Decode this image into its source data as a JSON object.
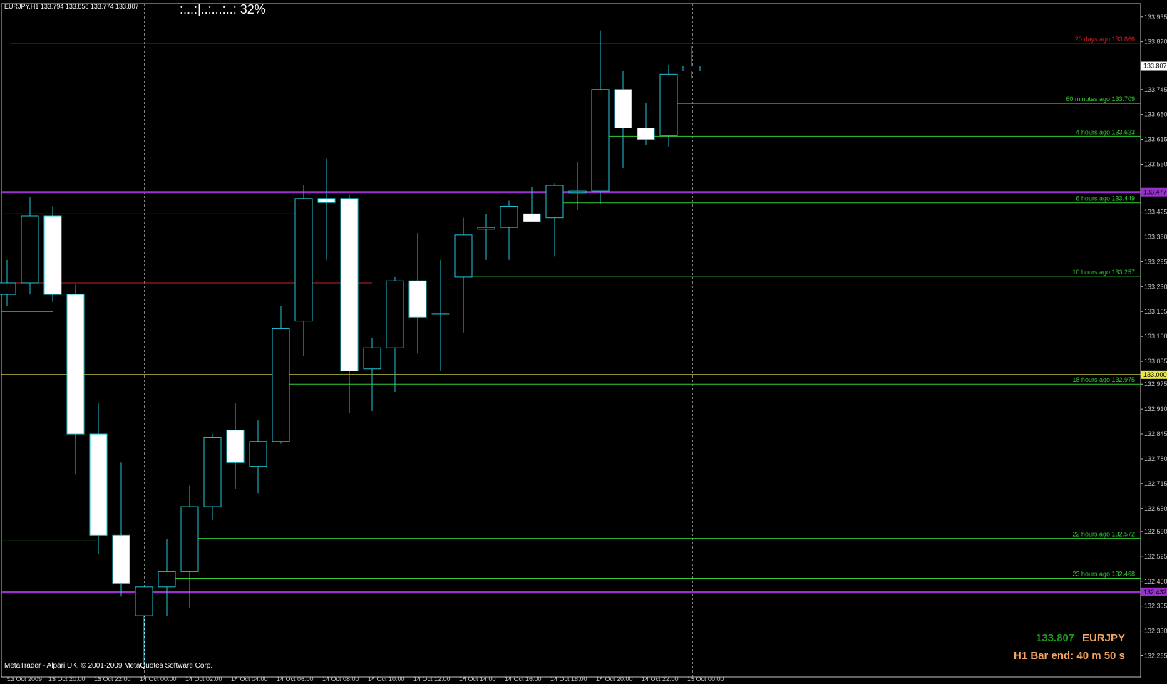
{
  "header": {
    "symbol_line": "EURJPY,H1  133.794 133.858 133.774 133.807",
    "progress_dots": ":...:|..:...:..:",
    "progress_pct": "32%"
  },
  "footer": {
    "copyright": "MetaTrader - Alpari UK, © 2001-2009 MetaQuotes Software Corp."
  },
  "badge": {
    "price": "133.807",
    "symbol": "EURJPY",
    "bar_end": "H1 Bar end: 40 m 50 s"
  },
  "colors": {
    "bear": "#ffffff",
    "bull_outline": "#22c8d8",
    "wick": "#22c8d8",
    "axis": "#c8c8c8",
    "level_green": "#33cc33",
    "level_red": "#cc2222",
    "pivot_purple": "#9932cc",
    "round_yellow": "#e8e84a",
    "bid_line": "#4a8ea8"
  },
  "chart_data": {
    "type": "candlestick",
    "symbol": "EURJPY",
    "timeframe": "H1",
    "ylim": [
      132.21,
      133.97
    ],
    "y_ticks": [
      133.935,
      133.87,
      133.745,
      133.68,
      133.615,
      133.55,
      133.425,
      133.36,
      133.295,
      133.23,
      133.165,
      133.1,
      133.035,
      132.975,
      132.91,
      132.845,
      132.78,
      132.715,
      132.65,
      132.59,
      132.525,
      132.46,
      132.395,
      132.33,
      132.265
    ],
    "x_labels": [
      "13 Oct 2009",
      "13 Oct 20:00",
      "13 Oct 22:00",
      "14 Oct 00:00",
      "14 Oct 02:00",
      "14 Oct 04:00",
      "14 Oct 06:00",
      "14 Oct 08:00",
      "14 Oct 10:00",
      "14 Oct 12:00",
      "14 Oct 14:00",
      "14 Oct 16:00",
      "14 Oct 18:00",
      "14 Oct 20:00",
      "14 Oct 22:00",
      "15 Oct 00:00"
    ],
    "candles": [
      {
        "o": 133.21,
        "h": 133.3,
        "l": 133.18,
        "c": 133.24
      },
      {
        "o": 133.24,
        "h": 133.465,
        "l": 133.21,
        "c": 133.415
      },
      {
        "o": 133.415,
        "h": 133.44,
        "l": 133.19,
        "c": 133.21
      },
      {
        "o": 133.21,
        "h": 133.235,
        "l": 132.74,
        "c": 132.845
      },
      {
        "o": 132.845,
        "h": 132.925,
        "l": 132.53,
        "c": 132.58
      },
      {
        "o": 132.58,
        "h": 132.77,
        "l": 132.42,
        "c": 132.455
      },
      {
        "o": 132.37,
        "h": 132.44,
        "l": 132.24,
        "c": 132.445
      },
      {
        "o": 132.445,
        "h": 132.57,
        "l": 132.37,
        "c": 132.485
      },
      {
        "o": 132.485,
        "h": 132.71,
        "l": 132.39,
        "c": 132.655
      },
      {
        "o": 132.655,
        "h": 132.845,
        "l": 132.62,
        "c": 132.835
      },
      {
        "o": 132.855,
        "h": 132.925,
        "l": 132.7,
        "c": 132.77
      },
      {
        "o": 132.76,
        "h": 132.88,
        "l": 132.69,
        "c": 132.825
      },
      {
        "o": 132.825,
        "h": 133.18,
        "l": 132.82,
        "c": 133.12
      },
      {
        "o": 133.14,
        "h": 133.495,
        "l": 133.05,
        "c": 133.46
      },
      {
        "o": 133.46,
        "h": 133.565,
        "l": 133.3,
        "c": 133.45
      },
      {
        "o": 133.46,
        "h": 133.47,
        "l": 132.9,
        "c": 133.01
      },
      {
        "o": 133.015,
        "h": 133.095,
        "l": 132.905,
        "c": 133.07
      },
      {
        "o": 133.07,
        "h": 133.255,
        "l": 132.955,
        "c": 133.245
      },
      {
        "o": 133.245,
        "h": 133.37,
        "l": 133.055,
        "c": 133.15
      },
      {
        "o": 133.16,
        "h": 133.3,
        "l": 133.01,
        "c": 133.16
      },
      {
        "o": 133.255,
        "h": 133.41,
        "l": 133.11,
        "c": 133.365
      },
      {
        "o": 133.38,
        "h": 133.42,
        "l": 133.3,
        "c": 133.385
      },
      {
        "o": 133.385,
        "h": 133.455,
        "l": 133.3,
        "c": 133.44
      },
      {
        "o": 133.42,
        "h": 133.49,
        "l": 133.4,
        "c": 133.4
      },
      {
        "o": 133.41,
        "h": 133.5,
        "l": 133.31,
        "c": 133.495
      },
      {
        "o": 133.475,
        "h": 133.555,
        "l": 133.43,
        "c": 133.48
      },
      {
        "o": 133.48,
        "h": 133.9,
        "l": 133.445,
        "c": 133.745
      },
      {
        "o": 133.745,
        "h": 133.795,
        "l": 133.54,
        "c": 133.645
      },
      {
        "o": 133.645,
        "h": 133.71,
        "l": 133.6,
        "c": 133.615
      },
      {
        "o": 133.625,
        "h": 133.81,
        "l": 133.595,
        "c": 133.785
      },
      {
        "o": 133.794,
        "h": 133.858,
        "l": 133.774,
        "c": 133.807
      }
    ],
    "levels": [
      {
        "label": "20 days ago 133.866",
        "price": 133.866,
        "color": "red",
        "start": 0
      },
      {
        "label": "60 minutes ago 133.709",
        "price": 133.709,
        "color": "green",
        "start": 29
      },
      {
        "label": "4 hours ago 133.623",
        "price": 133.623,
        "color": "green",
        "start": 26
      },
      {
        "label": "6 hours ago 133.449",
        "price": 133.449,
        "color": "green",
        "start": 24
      },
      {
        "label": "10 hours ago 133.257",
        "price": 133.257,
        "color": "green",
        "start": 20
      },
      {
        "label": "18 hours ago 132.975",
        "price": 132.975,
        "color": "green",
        "start": 12
      },
      {
        "label": "22 hours ago 132.572",
        "price": 132.572,
        "color": "green",
        "start": 8
      },
      {
        "label": "23 hours ago 132.468",
        "price": 132.468,
        "color": "green",
        "start": 7
      }
    ],
    "pivots": [
      {
        "label": "133.477",
        "price": 133.477
      },
      {
        "label": "132.432",
        "price": 132.432
      }
    ],
    "round_level": {
      "label": "133.000",
      "price": 133.0
    },
    "bid": {
      "label": "133.807",
      "price": 133.807
    },
    "short_levels": [
      {
        "price": 133.42,
        "color": "red",
        "from": 0,
        "to": 13
      },
      {
        "price": 133.165,
        "color": "green",
        "from": 0,
        "to": 2
      },
      {
        "price": 132.565,
        "color": "green",
        "from": 0,
        "to": 4
      },
      {
        "price": 133.24,
        "color": "red",
        "from": 15,
        "to": 16
      }
    ],
    "day_separators": [
      "14 Oct 00:00",
      "15 Oct 00:00"
    ]
  }
}
